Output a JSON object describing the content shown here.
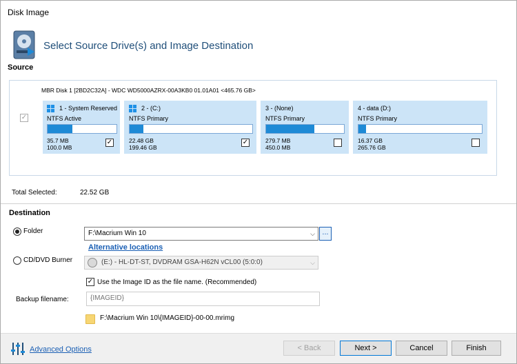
{
  "window": {
    "title": "Disk Image"
  },
  "header": {
    "title": "Select Source Drive(s) and Image Destination",
    "icon": "disk-image-icon"
  },
  "source": {
    "label": "Source",
    "disk_description": "MBR Disk 1 [2BD2C32A] - WDC WD5000AZRX-00A3KB0 01.01A01  <465.76 GB>",
    "disk_checked": true,
    "partitions": [
      {
        "name": "1 - System Reserved",
        "type": "NTFS Active",
        "used": "35.7 MB",
        "total": "100.0 MB",
        "checked": true,
        "fill": 0.36,
        "icon": "windows-logo-icon"
      },
      {
        "name": "2 -  (C:)",
        "type": "NTFS Primary",
        "used": "22.48 GB",
        "total": "199.46 GB",
        "checked": true,
        "fill": 0.11,
        "icon": "windows-logo-icon"
      },
      {
        "name": "3 -  (None)",
        "type": "NTFS Primary",
        "used": "279.7 MB",
        "total": "450.0 MB",
        "checked": false,
        "fill": 0.62
      },
      {
        "name": "4 - data (D:)",
        "type": "NTFS Primary",
        "used": "16.37 GB",
        "total": "265.76 GB",
        "checked": false,
        "fill": 0.06
      }
    ],
    "total_selected_label": "Total Selected:",
    "total_selected_value": "22.52 GB"
  },
  "destination": {
    "label": "Destination",
    "folder_label": "Folder",
    "folder_selected": true,
    "folder_value": "F:\\Macrium Win 10",
    "browse_label": "...",
    "alt_locations": "Alternative locations",
    "burner_label": "CD/DVD Burner",
    "burner_value": "(E:) - HL-DT-ST, DVDRAM GSA-H62N  vCL00 (5:0:0)",
    "use_image_id_label": "Use the Image ID as the file name.  (Recommended)",
    "use_image_id_checked": true,
    "backup_filename_label": "Backup filename:",
    "backup_filename_placeholder": "{IMAGEID}",
    "output_path": "F:\\Macrium Win 10\\{IMAGEID}-00-00.mrimg"
  },
  "footer": {
    "advanced_options": "Advanced Options",
    "back": "< Back",
    "next": "Next >",
    "cancel": "Cancel",
    "finish": "Finish"
  },
  "colors": {
    "accent": "#1e8ad6",
    "partition_bg": "#cce4f7",
    "header_text": "#1f4e79",
    "link": "#1a5fb4"
  }
}
